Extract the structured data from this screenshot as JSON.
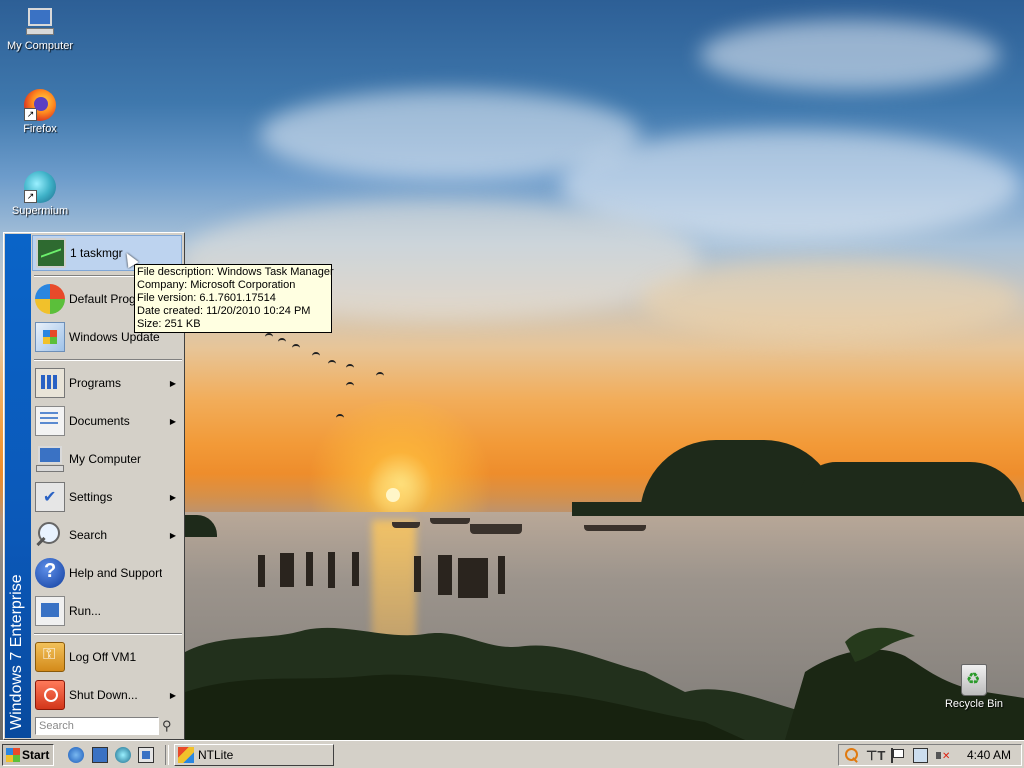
{
  "desktop": {
    "icons": [
      {
        "label": "My Computer",
        "icon": "my-computer-icon"
      },
      {
        "label": "Firefox",
        "icon": "firefox-icon"
      },
      {
        "label": "Supermium",
        "icon": "supermium-icon"
      },
      {
        "label": "Recycle Bin",
        "icon": "recycle-bin-icon"
      }
    ]
  },
  "start_menu": {
    "banner": "Windows 7 Enterprise",
    "items": [
      {
        "label": "1 taskmgr",
        "icon": "task-manager-icon",
        "submenu": false
      },
      {
        "label": "Default Programs",
        "icon": "default-programs-icon",
        "submenu": false
      },
      {
        "label": "Windows Update",
        "icon": "windows-update-icon",
        "submenu": false
      },
      {
        "label": "Programs",
        "icon": "programs-icon",
        "submenu": true
      },
      {
        "label": "Documents",
        "icon": "documents-icon",
        "submenu": true
      },
      {
        "label": "My Computer",
        "icon": "my-computer-icon",
        "submenu": false
      },
      {
        "label": "Settings",
        "icon": "settings-icon",
        "submenu": true
      },
      {
        "label": "Search",
        "icon": "search-icon",
        "submenu": true
      },
      {
        "label": "Help and Support",
        "icon": "help-icon",
        "submenu": false
      },
      {
        "label": "Run...",
        "icon": "run-icon",
        "submenu": false
      },
      {
        "label": "Log Off VM1",
        "icon": "log-off-icon",
        "submenu": false
      },
      {
        "label": "Shut Down...",
        "icon": "shut-down-icon",
        "submenu": true
      }
    ],
    "search_placeholder": "Search"
  },
  "tooltip": {
    "lines": [
      "File description: Windows Task Manager",
      "Company: Microsoft Corporation",
      "File version: 6.1.7601.17514",
      "Date created: 11/20/2010 10:24 PM",
      "Size: 251 KB"
    ]
  },
  "taskbar": {
    "start_label": "Start",
    "quick_launch": [
      "internet-explorer-icon",
      "show-desktop-icon",
      "supermium-icon",
      "switch-windows-icon"
    ],
    "tasks": [
      {
        "label": "NTLite",
        "icon": "ntlite-icon"
      }
    ],
    "tray_icons": [
      "search-tray-icon",
      "font-tray-icon",
      "action-center-flag-icon",
      "network-icon",
      "volume-muted-icon"
    ],
    "clock": "4:40 AM"
  },
  "colors": {
    "start_banner": "#0a64c8",
    "face": "#d4d0c8",
    "tooltip_bg": "#ffffe1",
    "highlight": "#bdd3ef"
  }
}
